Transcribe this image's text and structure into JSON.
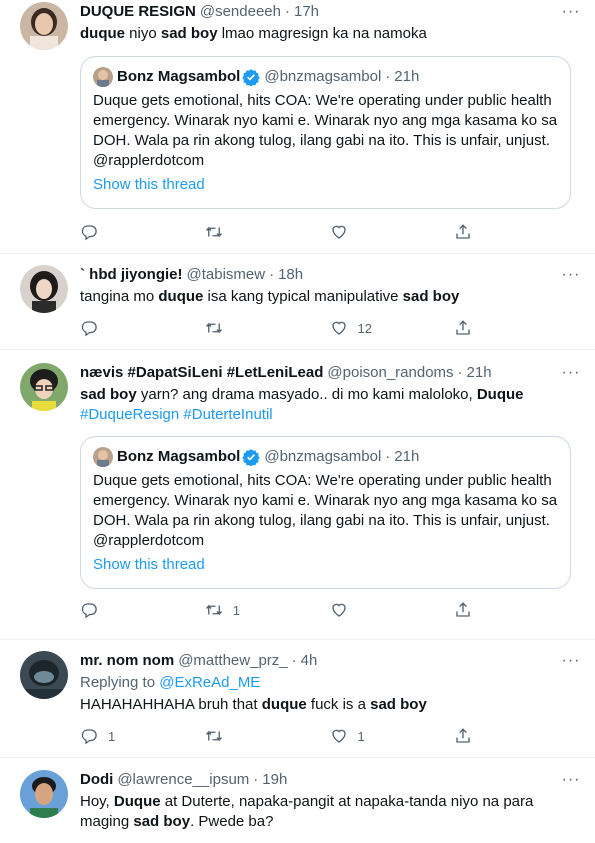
{
  "tweets": [
    {
      "name": "DUQUE RESIGN",
      "handle": "@sendeeeh",
      "time": "17h",
      "text_parts": [
        {
          "t": "duque",
          "b": true
        },
        {
          "t": " niyo "
        },
        {
          "t": "sad boy",
          "b": true
        },
        {
          "t": " lmao magresign ka na namoka"
        }
      ],
      "quote": {
        "name": "Bonz Magsambol",
        "handle": "@bnzmagsambol",
        "time": "21h",
        "text": "Duque gets emotional, hits COA: We're operating under public health emergency. Winarak nyo kami e. Winarak nyo ang mga kasama ko sa DOH. Wala pa rin akong tulog, ilang gabi na ito. This is unfair, unjust. @rapplerdotcom",
        "show_thread": "Show this thread"
      },
      "counts": {
        "reply": "",
        "retweet": "",
        "like": ""
      }
    },
    {
      "name": "` hbd jiyongie!",
      "handle": "@tabismew",
      "time": "18h",
      "text_parts": [
        {
          "t": "tangina mo "
        },
        {
          "t": "duque",
          "b": true
        },
        {
          "t": " isa kang typical manipulative "
        },
        {
          "t": "sad boy",
          "b": true
        }
      ],
      "counts": {
        "reply": "",
        "retweet": "",
        "like": "12"
      }
    },
    {
      "name": "nævis #DapatSiLeni #LetLeniLead",
      "handle": "@poison_randoms",
      "time": "21h",
      "text_parts": [
        {
          "t": "sad boy",
          "b": true
        },
        {
          "t": " yarn? ang drama masyado.. di mo kami maloloko, "
        },
        {
          "t": "Duque",
          "b": true
        }
      ],
      "hashtags": "#DuqueResign #DuterteInutil",
      "quote": {
        "name": "Bonz Magsambol",
        "handle": "@bnzmagsambol",
        "time": "21h",
        "text": "Duque gets emotional, hits COA: We're operating under public health emergency. Winarak nyo kami e. Winarak nyo ang mga kasama ko sa DOH. Wala pa rin akong tulog, ilang gabi na ito. This is unfair, unjust. @rapplerdotcom",
        "show_thread": "Show this thread"
      },
      "counts": {
        "reply": "",
        "retweet": "1",
        "like": ""
      }
    },
    {
      "name": "mr. nom nom",
      "handle": "@matthew_prz_",
      "time": "4h",
      "replying_label": "Replying to ",
      "replying_handle": "@ExReAd_ME",
      "text_parts": [
        {
          "t": "HAHAHAHHAHA bruh that "
        },
        {
          "t": "duque",
          "b": true
        },
        {
          "t": " fuck is a "
        },
        {
          "t": "sad boy",
          "b": true
        }
      ],
      "counts": {
        "reply": "1",
        "retweet": "",
        "like": "1"
      }
    },
    {
      "name": "Dodi",
      "handle": "@lawrence__ipsum",
      "time": "19h",
      "text_parts": [
        {
          "t": "Hoy, "
        },
        {
          "t": "Duque",
          "b": true
        },
        {
          "t": " at Duterte, napaka-pangit at napaka-tanda niyo na para maging "
        },
        {
          "t": "sad boy",
          "b": true
        },
        {
          "t": ". Pwede ba?"
        }
      ]
    }
  ],
  "ui": {
    "dot": "·",
    "more_icon": "more-horizontal-icon"
  },
  "colors": {
    "accent": "#1d9bf0",
    "text": "#0f1419",
    "secondary": "#536471",
    "border": "#eff3f4",
    "quote_border": "#cfd9de"
  }
}
